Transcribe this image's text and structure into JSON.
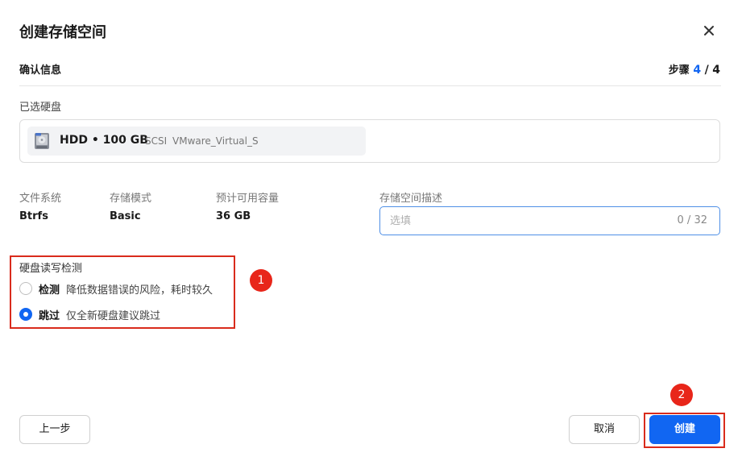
{
  "dialog": {
    "title": "创建存储空间",
    "close_icon": "close-icon"
  },
  "header": {
    "section": "确认信息",
    "step_prefix": "步骤",
    "step_current": "4",
    "step_sep": "/",
    "step_total": "4"
  },
  "disk": {
    "label": "已选硬盘",
    "icon": "hard-disk-icon",
    "type_size": "HDD • 100 GB",
    "bus": "SCSI",
    "model": "VMware_Virtual_S"
  },
  "summary": {
    "filesystem_label": "文件系统",
    "filesystem_value": "Btrfs",
    "mode_label": "存储模式",
    "mode_value": "Basic",
    "capacity_label": "预计可用容量",
    "capacity_value": "36 GB",
    "desc_label": "存储空间描述",
    "desc_placeholder": "选填",
    "desc_value": "",
    "desc_counter": "0 / 32"
  },
  "check": {
    "title": "硬盘读写检测",
    "options": [
      {
        "name": "检测",
        "desc": "降低数据错误的风险，耗时较久",
        "selected": false
      },
      {
        "name": "跳过",
        "desc": "仅全新硬盘建议跳过",
        "selected": true
      }
    ]
  },
  "annotations": {
    "badge_1": "1",
    "badge_2": "2",
    "color": "#e8261a"
  },
  "footer": {
    "prev_label": "上一步",
    "cancel_label": "取消",
    "create_label": "创建"
  },
  "colors": {
    "accent": "#1166f2",
    "highlight": "#d92b1c"
  }
}
